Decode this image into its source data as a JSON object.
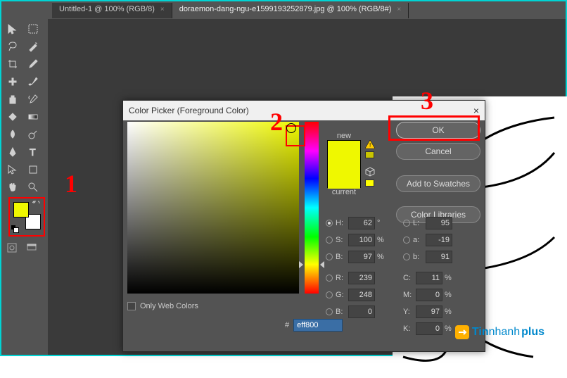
{
  "tabs": {
    "untitled": "Untitled-1 @ 100% (RGB/8)",
    "active": "doraemon-dang-ngu-e1599193252879.jpg @ 100% (RGB/8#)"
  },
  "dialog": {
    "title": "Color Picker (Foreground Color)",
    "close": "×",
    "buttons": {
      "ok": "OK",
      "cancel": "Cancel",
      "add": "Add to Swatches",
      "libs": "Color Libraries"
    },
    "nc": {
      "new": "new",
      "current": "current"
    },
    "labels": {
      "H": "H:",
      "S": "S:",
      "B": "B:",
      "R": "R:",
      "G": "G:",
      "Bc": "B:",
      "L": "L:",
      "a": "a:",
      "bl": "b:",
      "C": "C:",
      "M": "M:",
      "Y": "Y:",
      "K": "K:"
    },
    "values": {
      "H": "62",
      "S": "100",
      "B": "97",
      "R": "239",
      "G": "248",
      "Bc": "0",
      "L": "95",
      "a": "-19",
      "bl": "91",
      "C": "11",
      "M": "0",
      "Y": "97",
      "K": "0"
    },
    "units": {
      "deg": "°",
      "pct": "%"
    },
    "only_web": "Only Web Colors",
    "hex_hash": "#",
    "hex": "eff800"
  },
  "annotations": {
    "n1": "1",
    "n2": "2",
    "n3": "3"
  },
  "watermark": {
    "t1": "Tin",
    "t2": "nhanh",
    "t3": "plus"
  },
  "colors": {
    "picked": "#eff800"
  }
}
